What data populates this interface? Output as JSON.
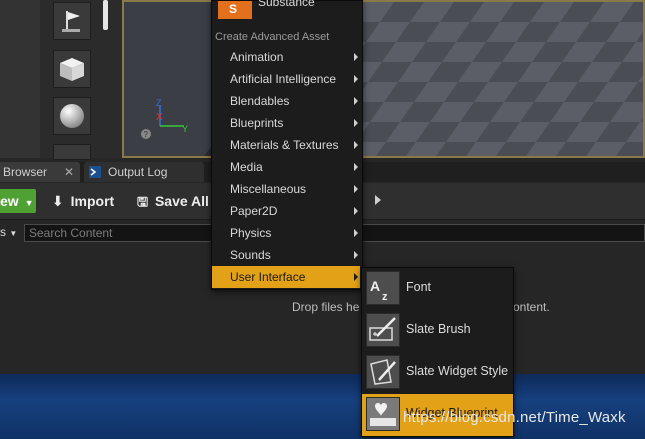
{
  "menu": {
    "top_item": "Substance",
    "section_header": "Create Advanced Asset",
    "items": [
      {
        "label": "Animation"
      },
      {
        "label": "Artificial Intelligence"
      },
      {
        "label": "Blendables"
      },
      {
        "label": "Blueprints"
      },
      {
        "label": "Materials & Textures"
      },
      {
        "label": "Media"
      },
      {
        "label": "Miscellaneous"
      },
      {
        "label": "Paper2D"
      },
      {
        "label": "Physics"
      },
      {
        "label": "Sounds"
      },
      {
        "label": "User Interface"
      }
    ],
    "active_index": 10
  },
  "submenu": {
    "items": [
      {
        "label": "Font",
        "icon": "font-az-icon"
      },
      {
        "label": "Slate Brush",
        "icon": "slate-brush-icon"
      },
      {
        "label": "Slate Widget Style",
        "icon": "slate-widget-style-icon"
      },
      {
        "label": "Widget Blueprint",
        "icon": "widget-blueprint-icon"
      }
    ]
  },
  "tabs": {
    "content_browser": "Browser",
    "output_log": "Output Log"
  },
  "toolbar": {
    "add_new": "ew",
    "import": "Import",
    "save_all": "Save All"
  },
  "search": {
    "filters_partial": "s",
    "placeholder": "Search Content"
  },
  "drop_hint": {
    "left": "Drop files he",
    "right": "ontent."
  },
  "watermark": "https://blog.csdn.net/Time_Waxk",
  "colors": {
    "accent": "#e2a116",
    "add_new_green": "#4fa133",
    "menu_bg": "#1c1c1c"
  }
}
